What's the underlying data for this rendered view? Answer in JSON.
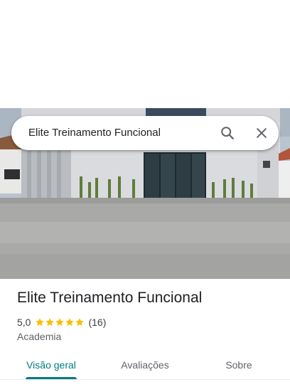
{
  "search": {
    "query": "Elite Treinamento Funcional",
    "search_icon": "search-icon",
    "close_icon": "close-icon"
  },
  "place": {
    "name": "Elite Treinamento Funcional",
    "rating": "5,0",
    "stars": 5,
    "review_count": "(16)",
    "category": "Academia"
  },
  "tabs": [
    {
      "label": "Visão geral",
      "active": true
    },
    {
      "label": "Avaliações",
      "active": false
    },
    {
      "label": "Sobre",
      "active": false
    }
  ],
  "colors": {
    "accent": "#007b83",
    "star": "#fbbc04"
  }
}
